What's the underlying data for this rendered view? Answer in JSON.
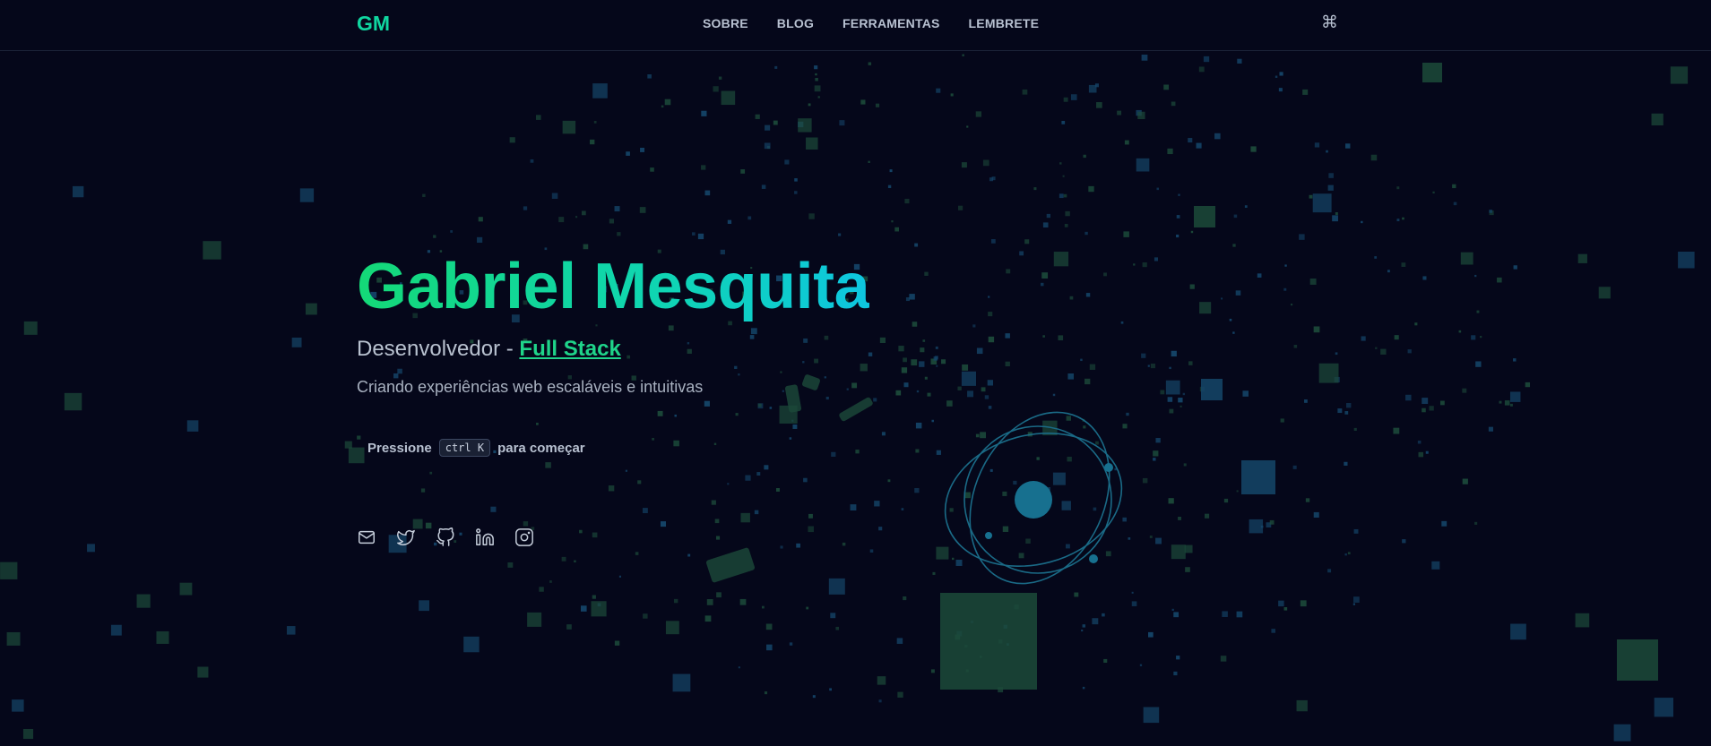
{
  "header": {
    "logo": "GM",
    "nav": [
      "SOBRE",
      "BLOG",
      "FERRAMENTAS",
      "LEMBRETE"
    ],
    "command_icon": "⌘"
  },
  "hero": {
    "title": "Gabriel Mesquita",
    "subtitle_prefix": "Desenvolvedor - ",
    "subtitle_link": "Full Stack",
    "tagline": "Criando experiências web escaláveis e intuitivas",
    "press_label": "Pressione",
    "shortcut": "ctrl K",
    "press_suffix": "para começar"
  },
  "socials": [
    "mail-icon",
    "twitter-icon",
    "github-icon",
    "linkedin-icon",
    "instagram-icon"
  ],
  "colors": {
    "background": "#05071a",
    "accent_green": "#14d977",
    "accent_cyan": "#0ec6e0",
    "particle_green": "#1c4a3a",
    "particle_blue": "#15466a"
  }
}
